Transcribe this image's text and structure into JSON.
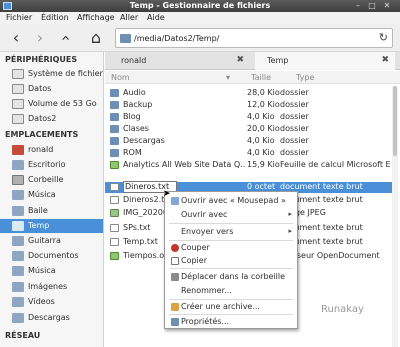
{
  "window": {
    "title": "Temp - Gestionnaire de fichiers",
    "controls": [
      "–",
      "□",
      "✕"
    ]
  },
  "menubar": [
    "Fichier",
    "Édition",
    "Affichage",
    "Aller",
    "Aide"
  ],
  "toolbar": {
    "back": "‹",
    "forward": "›",
    "up": "‹",
    "home": "⌂",
    "location": "/media/Datos2/Temp/",
    "refresh": "↻"
  },
  "sidebar": {
    "devices_heading": "PÉRIPHÉRIQUES",
    "devices": [
      {
        "label": "Système de fichiers",
        "icon": "drive-icon"
      },
      {
        "label": "Datos",
        "icon": "drive-icon"
      },
      {
        "label": "Volume de 53 Go",
        "icon": "drive-icon"
      },
      {
        "label": "Datos2",
        "icon": "drive-icon"
      }
    ],
    "places_heading": "EMPLACEMENTS",
    "places": [
      {
        "label": "ronald",
        "icon": "home-icon"
      },
      {
        "label": "Escritorio",
        "icon": "folder-icon"
      },
      {
        "label": "Corbeille",
        "icon": "trash-icon"
      },
      {
        "label": "Música",
        "icon": "folder-icon"
      },
      {
        "label": "Baile",
        "icon": "folder-icon"
      },
      {
        "label": "Temp",
        "icon": "folder-icon",
        "selected": true
      },
      {
        "label": "Guitarra",
        "icon": "folder-icon"
      },
      {
        "label": "Documentos",
        "icon": "folder-icon"
      },
      {
        "label": "Música",
        "icon": "folder-icon"
      },
      {
        "label": "Imágenes",
        "icon": "folder-icon"
      },
      {
        "label": "Vídeos",
        "icon": "folder-icon"
      },
      {
        "label": "Descargas",
        "icon": "folder-icon"
      }
    ],
    "network_heading": "RÉSEAU"
  },
  "tabs": [
    {
      "label": "ronald",
      "close": "✖"
    },
    {
      "label": "Temp",
      "close": "✖"
    }
  ],
  "columns": {
    "name": "Nom",
    "size": "Taille",
    "type": "Type",
    "sort_indicator": "▾"
  },
  "files": [
    {
      "name": "Audio",
      "size": "28,0 Kio",
      "type": "dossier",
      "kind": "folder"
    },
    {
      "name": "Backup",
      "size": "12,0 Kio",
      "type": "dossier",
      "kind": "folder"
    },
    {
      "name": "Blog",
      "size": "4,0 Kio",
      "type": "dossier",
      "kind": "folder"
    },
    {
      "name": "Clases",
      "size": "20,0 Kio",
      "type": "dossier",
      "kind": "folder"
    },
    {
      "name": "Descargas",
      "size": "4,0 Kio",
      "type": "dossier",
      "kind": "folder"
    },
    {
      "name": "ROM",
      "size": "4,0 Kio",
      "type": "dossier",
      "kind": "folder"
    },
    {
      "name": "Analytics All Web Site Data Q...",
      "size": "15,9 Kio",
      "type": "Feuille de calcul Microsoft E",
      "kind": "sheet"
    },
    {
      "name": "Dineros.txt",
      "size": "0 octet",
      "type": "document texte brut",
      "kind": "doc",
      "selected": true
    },
    {
      "name": "Dineros2.txt",
      "size": "",
      "type": "document texte brut",
      "kind": "doc"
    },
    {
      "name": "IMG_202001...",
      "size": "",
      "type": "image JPEG",
      "kind": "img"
    },
    {
      "name": "SPs.txt",
      "size": "",
      "type": "document texte brut",
      "kind": "doc"
    },
    {
      "name": "Temp.txt",
      "size": "",
      "type": "document texte brut",
      "kind": "doc"
    },
    {
      "name": "Tiempos.ods",
      "size": "",
      "type": "Classeur OpenDocument",
      "kind": "sheet"
    }
  ],
  "context_menu": [
    {
      "label": "Ouvrir avec « Mousepad »",
      "icon": "mousepad-icon"
    },
    {
      "label": "Ouvrir avec",
      "submenu": true
    },
    {
      "separator": true
    },
    {
      "label": "Envoyer vers",
      "submenu": true
    },
    {
      "separator": true
    },
    {
      "label": "Couper",
      "icon": "cut-icon"
    },
    {
      "label": "Copier",
      "icon": "copy-icon"
    },
    {
      "separator": true
    },
    {
      "label": "Déplacer dans la corbeille",
      "icon": "trash-icon"
    },
    {
      "label": "Renommer..."
    },
    {
      "separator": true
    },
    {
      "label": "Créer une archive...",
      "icon": "archive-icon"
    },
    {
      "separator": true
    },
    {
      "label": "Propriétés...",
      "icon": "properties-icon"
    }
  ],
  "submenu_arrow": "▸",
  "watermark": "Runakay",
  "colors": {
    "accent": "#4a90d9",
    "titlebar": "#4a4a4a"
  }
}
